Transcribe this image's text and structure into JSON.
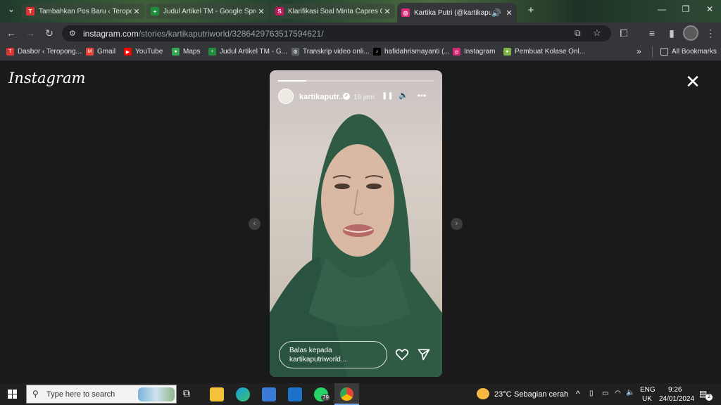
{
  "browser": {
    "tabs": [
      {
        "title": "Tambahkan Pos Baru ‹ Teropo",
        "fav": "T",
        "color": "#d33"
      },
      {
        "title": "Judul Artikel TM - Google Spre",
        "fav": "+",
        "color": "#1e8e3e"
      },
      {
        "title": "Klarifikasi Soal Minta Capres C",
        "fav": "S",
        "color": "#c2185b"
      },
      {
        "title": "Kartika Putri (@kartikaputri",
        "fav": "◎",
        "color": "#d62976",
        "active": true
      }
    ],
    "new_tab": "+",
    "url_host": "instagram.com",
    "url_path": "/stories/kartikaputriworld/3286429763517594621/",
    "bookmarks": [
      {
        "label": "Dasbor ‹ Teropong...",
        "color": "#d33",
        "icon": "T"
      },
      {
        "label": "Gmail",
        "color": "#ea4335",
        "icon": "M"
      },
      {
        "label": "YouTube",
        "color": "#f00",
        "icon": "▶"
      },
      {
        "label": "Maps",
        "color": "#34a853",
        "icon": "●"
      },
      {
        "label": "Judul Artikel TM - G...",
        "color": "#1e8e3e",
        "icon": "+"
      },
      {
        "label": "Transkrip video onli...",
        "color": "#5f6368",
        "icon": "⚙"
      },
      {
        "label": "hafidahrismayanti (...",
        "color": "#000",
        "icon": "♪"
      },
      {
        "label": "Instagram",
        "color": "#d62976",
        "icon": "◎"
      },
      {
        "label": "Pembuat Kolase Onl...",
        "color": "#7cb342",
        "icon": "●"
      }
    ],
    "all_bookmarks": "All Bookmarks",
    "more_bookmarks": "»"
  },
  "instagram": {
    "logo": "Instagram",
    "close": "✕",
    "prev": "‹",
    "next": "›",
    "story": {
      "username": "kartikaputr...",
      "time": "19 jam",
      "progress": 0.18,
      "reply_placeholder": "Balas kepada kartikaputriworld...",
      "pause": "❚❚",
      "volume": "🔊",
      "more": "•••"
    }
  },
  "taskbar": {
    "search_placeholder": "Type here to search",
    "whatsapp_badge": "79",
    "weather_temp": "23°C",
    "weather_desc": "Sebagian cerah",
    "lang1": "ENG",
    "lang2": "UK",
    "time": "9:26",
    "date": "24/01/2024",
    "notif_count": "2"
  }
}
